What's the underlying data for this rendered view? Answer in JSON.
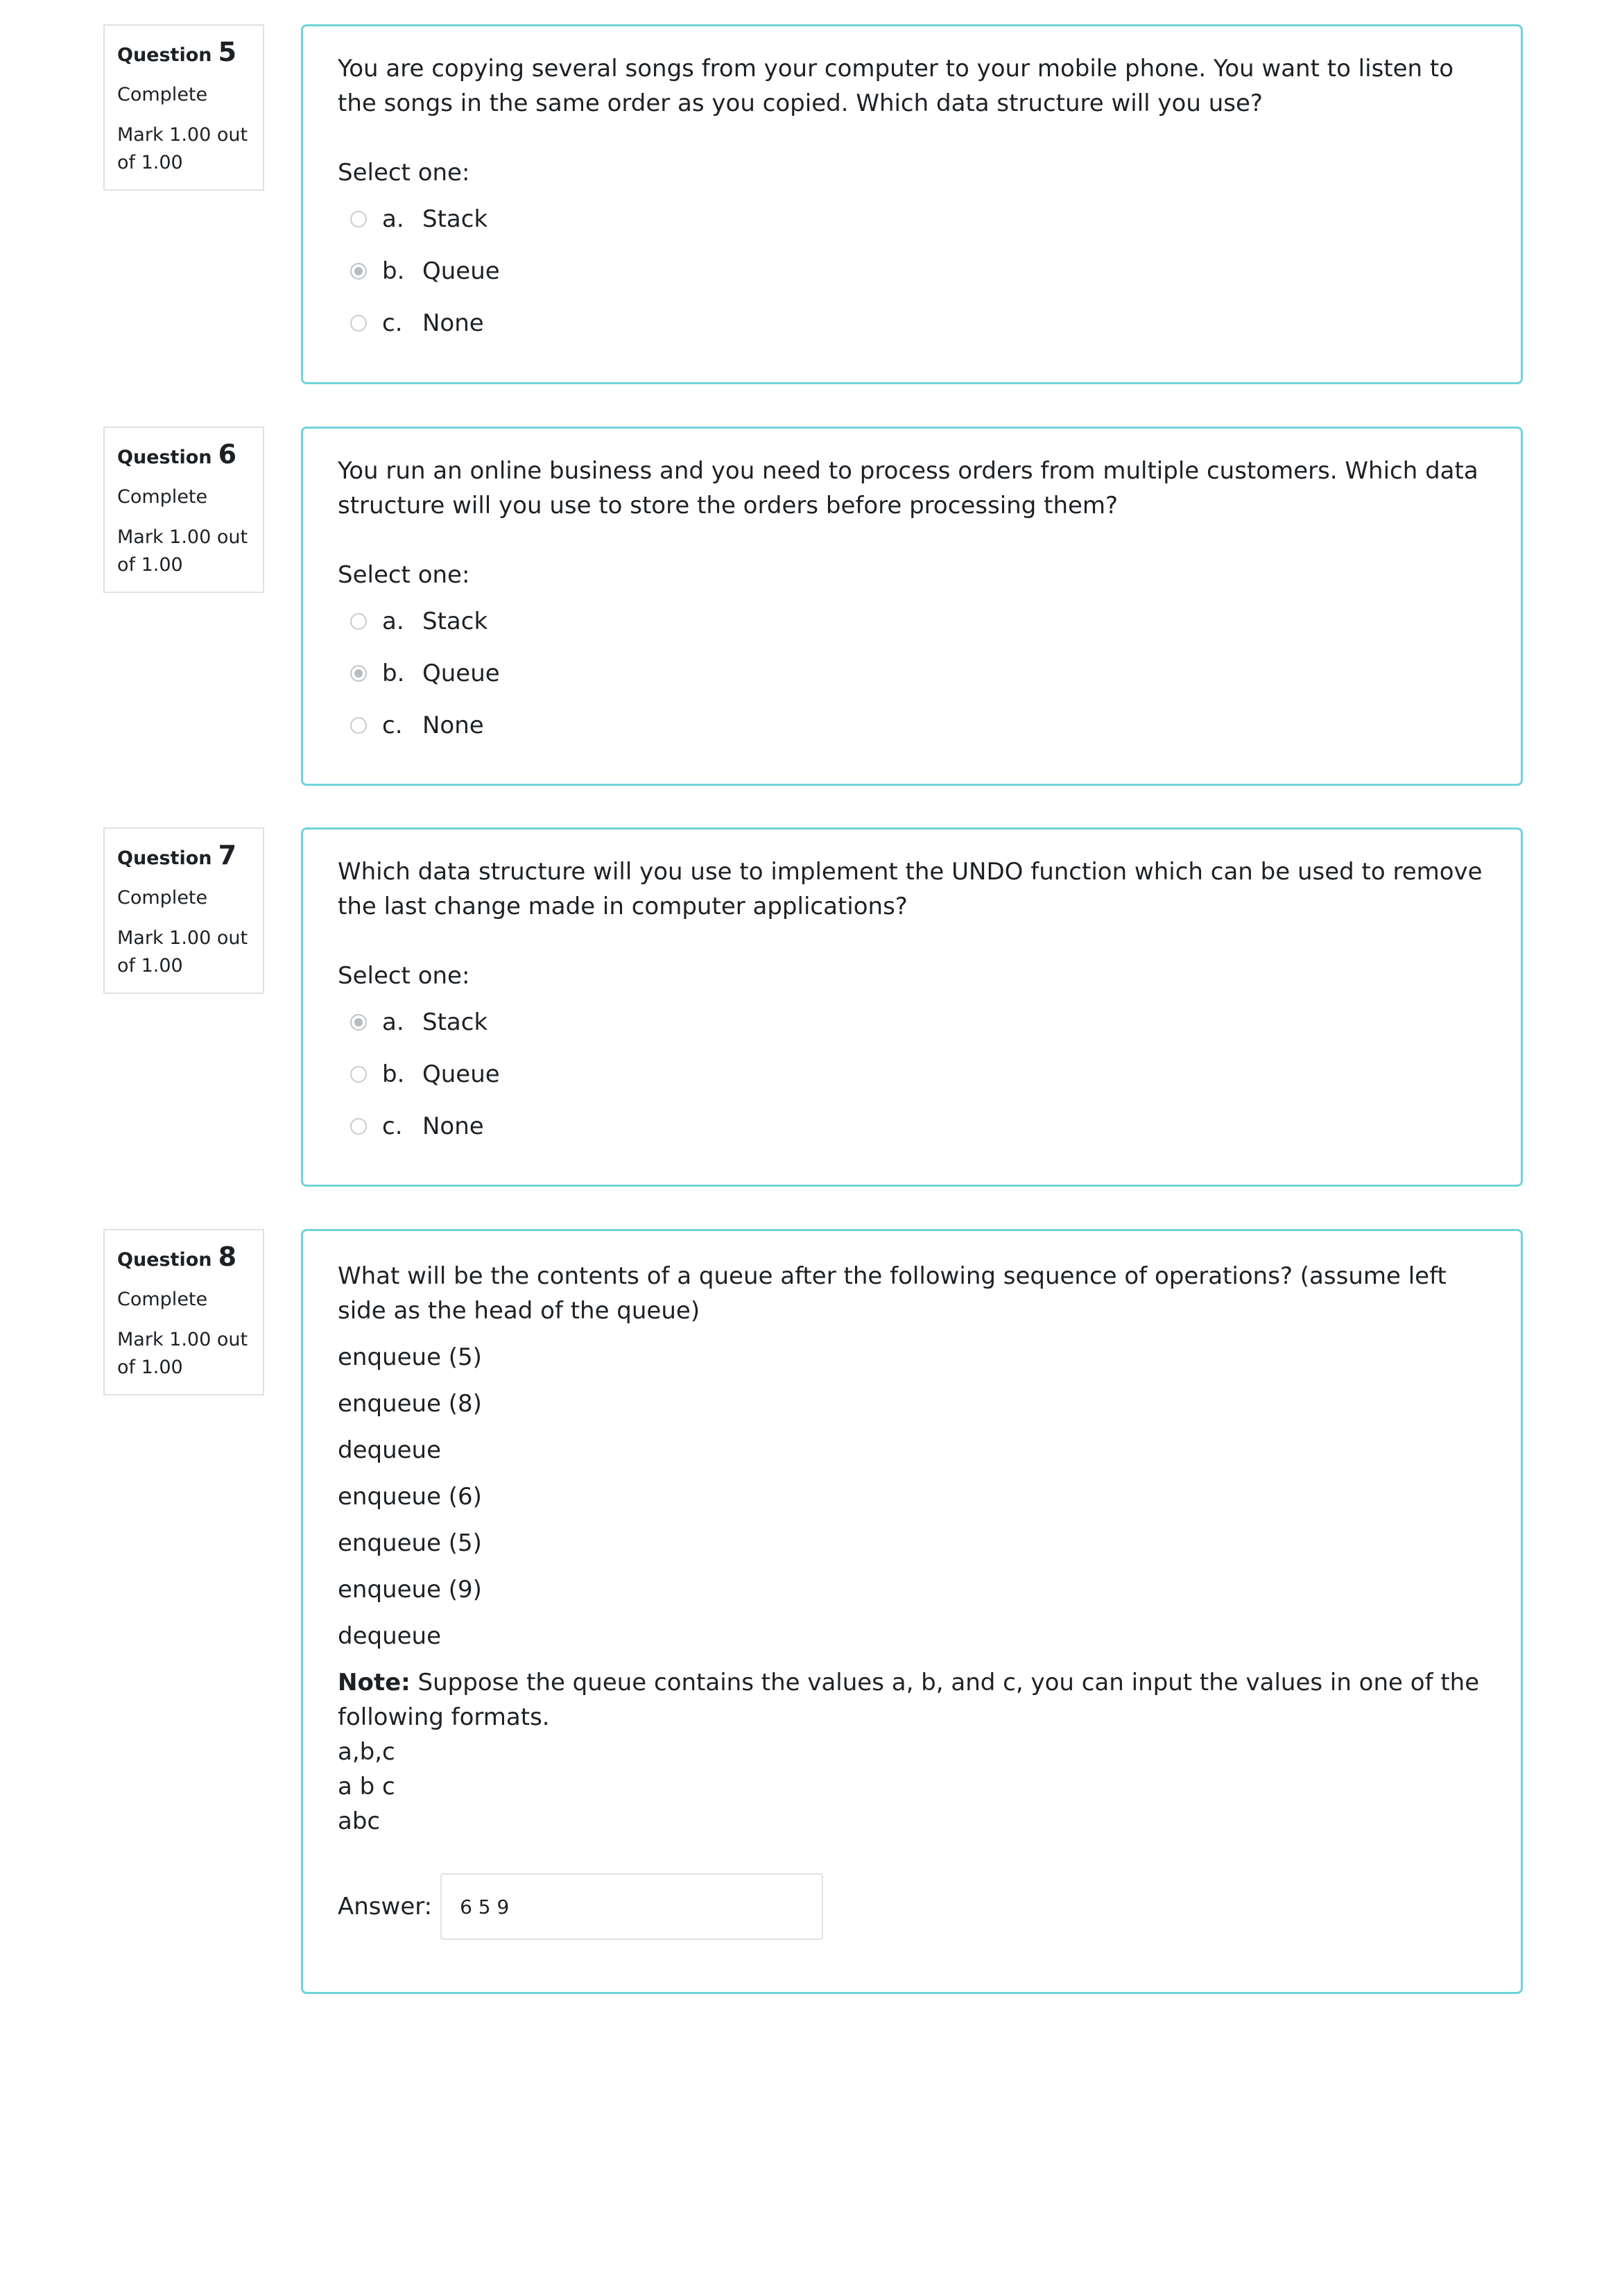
{
  "questions": [
    {
      "label": "Question",
      "number": "5",
      "state": "Complete",
      "grade": "Mark 1.00 out of 1.00",
      "text": "You are copying several songs from your computer to your mobile phone. You want to listen to the songs in the same order as you copied. Which data structure will you use?",
      "prompt": "Select one:",
      "options": [
        {
          "letter": "a.",
          "label": "Stack"
        },
        {
          "letter": "b.",
          "label": "Queue"
        },
        {
          "letter": "c.",
          "label": "None"
        }
      ],
      "selected": "b."
    },
    {
      "label": "Question",
      "number": "6",
      "state": "Complete",
      "grade": "Mark 1.00 out of 1.00",
      "text": "You run an online business and you need to process orders from multiple customers. Which data structure will you use to store the orders before processing them?",
      "prompt": "Select one:",
      "options": [
        {
          "letter": "a.",
          "label": "Stack"
        },
        {
          "letter": "b.",
          "label": "Queue"
        },
        {
          "letter": "c.",
          "label": "None"
        }
      ],
      "selected": "b."
    },
    {
      "label": "Question",
      "number": "7",
      "state": "Complete",
      "grade": "Mark 1.00 out of 1.00",
      "text": "Which data structure will you use to implement the UNDO function which can be used to remove the last change made in computer applications?",
      "prompt": "Select one:",
      "options": [
        {
          "letter": "a.",
          "label": "Stack"
        },
        {
          "letter": "b.",
          "label": "Queue"
        },
        {
          "letter": "c.",
          "label": "None"
        }
      ],
      "selected": "a."
    },
    {
      "label": "Question",
      "number": "8",
      "state": "Complete",
      "grade": "Mark 1.00 out of 1.00",
      "text": "What will be the contents of a queue after the following sequence of operations? (assume left side as the head of the queue)",
      "operations": [
        "enqueue (5)",
        "enqueue (8)",
        "dequeue",
        "enqueue (6)",
        "enqueue (5)",
        "enqueue (9)",
        "dequeue"
      ],
      "note_label": "Note:",
      "note_text": " Suppose the queue contains the values a, b, and c, you can input the values in one of the following formats.",
      "formats": [
        "a,b,c",
        "a b c",
        "abc"
      ],
      "answer_label": "Answer:",
      "answer_value": "6 5 9"
    }
  ]
}
